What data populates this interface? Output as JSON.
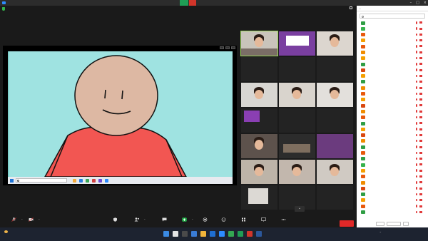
{
  "window": {
    "title": ""
  },
  "share_banner": {
    "sharing_text": "",
    "stop_label": ""
  },
  "top_bar": {
    "view_label": ""
  },
  "shared_screen": {
    "taskbar_search_placeholder": "",
    "taskbar_weather": "",
    "taskbar_time": "",
    "taskbar_date": ""
  },
  "gallery": {
    "tiles": [
      {
        "name": ""
      },
      {
        "name": ""
      },
      {
        "name": ""
      },
      {
        "name": ""
      },
      {
        "name": ""
      },
      {
        "name": ""
      },
      {
        "name": ""
      },
      {
        "name": ""
      },
      {
        "name": "",
        "center": ""
      },
      {
        "name": "",
        "center": ""
      },
      {
        "name": "",
        "center": ""
      },
      {
        "name": "",
        "center": ""
      },
      {
        "name": "",
        "center": ""
      },
      {
        "name": "",
        "center": ""
      },
      {
        "name": ""
      },
      {
        "name": ""
      },
      {
        "name": ""
      },
      {
        "name": "",
        "center": ""
      },
      {
        "name": ""
      },
      {
        "name": ""
      },
      {
        "name": ""
      },
      {
        "name": ""
      },
      {
        "name": ""
      },
      {
        "name": "",
        "center": ""
      },
      {
        "name": "",
        "center": ""
      },
      {
        "name": "",
        "center": ""
      },
      {
        "name": ""
      },
      {
        "name": ""
      },
      {
        "name": ""
      }
    ],
    "nav_arrow": "⌄"
  },
  "toolbar": {
    "mute_label": "",
    "video_label": "",
    "security_label": "",
    "participants_label": "",
    "participants_count": "",
    "chat_label": "",
    "share_label": "",
    "record_label": "",
    "reactions_label": "",
    "apps_label": "",
    "whiteboard_label": "",
    "more_label": "",
    "leave_label": ""
  },
  "participants_panel": {
    "title": "",
    "search_placeholder": "",
    "items": [
      {
        "name": "",
        "avatar_color": "#2f9e44"
      },
      {
        "name": "",
        "avatar_color": "#37b24d"
      },
      {
        "name": "",
        "avatar_color": "#e8590c"
      },
      {
        "name": "",
        "avatar_color": "#f59f00"
      },
      {
        "name": "",
        "avatar_color": "#e8590c"
      },
      {
        "name": "",
        "avatar_color": "#f08c00"
      },
      {
        "name": "",
        "avatar_color": "#f59f00"
      },
      {
        "name": "",
        "avatar_color": "#2f9e44"
      },
      {
        "name": "",
        "avatar_color": "#d9480f"
      },
      {
        "name": "",
        "avatar_color": "#f59f00"
      },
      {
        "name": "",
        "avatar_color": "#2f9e44"
      },
      {
        "name": "",
        "avatar_color": "#f08c00"
      },
      {
        "name": "",
        "avatar_color": "#e8590c"
      },
      {
        "name": "",
        "avatar_color": "#f59f00"
      },
      {
        "name": "",
        "avatar_color": "#d9480f"
      },
      {
        "name": "",
        "avatar_color": "#f08c00"
      },
      {
        "name": "",
        "avatar_color": "#e8590c"
      },
      {
        "name": "",
        "avatar_color": "#2f9e44"
      },
      {
        "name": "",
        "avatar_color": "#f59f00"
      },
      {
        "name": "",
        "avatar_color": "#d9480f"
      },
      {
        "name": "",
        "avatar_color": "#f08c00"
      },
      {
        "name": "",
        "avatar_color": "#2f9e44"
      },
      {
        "name": "",
        "avatar_color": "#e8590c"
      },
      {
        "name": "",
        "avatar_color": "#2f9e44"
      },
      {
        "name": "",
        "avatar_color": "#37b24d"
      },
      {
        "name": "",
        "avatar_color": "#f59f00"
      },
      {
        "name": "",
        "avatar_color": "#e8590c"
      },
      {
        "name": "",
        "avatar_color": "#f08c00"
      },
      {
        "name": "",
        "avatar_color": "#d9480f"
      },
      {
        "name": "",
        "avatar_color": "#2f9e44"
      },
      {
        "name": "",
        "avatar_color": "#f59f00"
      },
      {
        "name": "",
        "avatar_color": "#e8590c"
      },
      {
        "name": "",
        "avatar_color": "#2f9e44"
      }
    ],
    "invite_label": "",
    "mute_all_label": "",
    "more_label": ""
  },
  "os_taskbar": {
    "weather_temp": "",
    "weather_desc": "",
    "tray_lang": "",
    "time": "",
    "date": ""
  },
  "colors": {
    "accent": "#2d8cff",
    "leave": "#e02828",
    "share_green": "#1f9d55",
    "canvas_bg": "#9fe3e1",
    "shirt": "#f25652",
    "face": "#ddb8a3",
    "active_tile": "#9ad65a"
  }
}
